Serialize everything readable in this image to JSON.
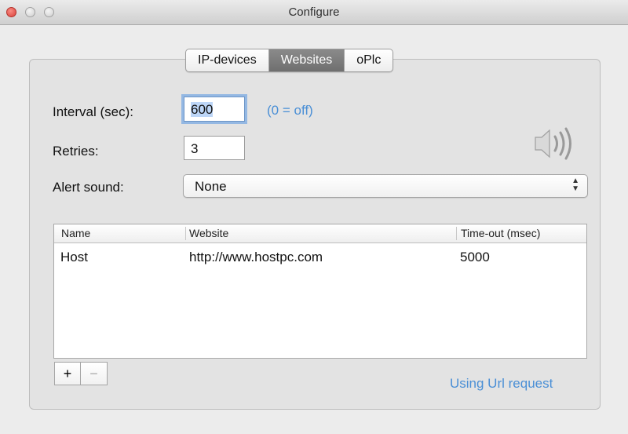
{
  "window": {
    "title": "Configure"
  },
  "tabs": [
    {
      "label": "IP-devices",
      "active": false
    },
    {
      "label": "Websites",
      "active": true
    },
    {
      "label": "oPlc",
      "active": false
    }
  ],
  "form": {
    "interval_label": "Interval (sec):",
    "interval_value": "600",
    "interval_hint": "(0 = off)",
    "retries_label": "Retries:",
    "retries_value": "3",
    "alert_sound_label": "Alert sound:",
    "alert_sound_value": "None"
  },
  "table": {
    "columns": [
      "Name",
      "Website",
      "Time-out (msec)"
    ],
    "rows": [
      {
        "name": "Host",
        "website": "http://www.hostpc.com",
        "timeout": "5000"
      }
    ]
  },
  "toolbar": {
    "add_label": "+",
    "remove_label": "−"
  },
  "status": {
    "request_mode": "Using Url request"
  },
  "icons": {
    "sound": "speaker-icon"
  },
  "colors": {
    "accent": "#4a8fd6",
    "selected_tab": "#7c7c7c",
    "close": "#e0443e"
  }
}
